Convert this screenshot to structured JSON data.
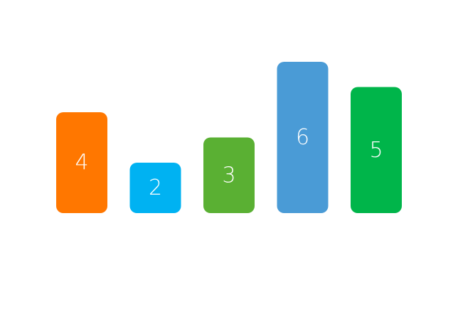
{
  "chart_data": {
    "type": "bar",
    "values": [
      4,
      2,
      3,
      6,
      5
    ],
    "labels": [
      "4",
      "2",
      "3",
      "6",
      "5"
    ],
    "colors": [
      "#FF7700",
      "#00B2F2",
      "#5AB033",
      "#4A9BD6",
      "#00B54A"
    ],
    "grid": false,
    "legend": "none"
  }
}
